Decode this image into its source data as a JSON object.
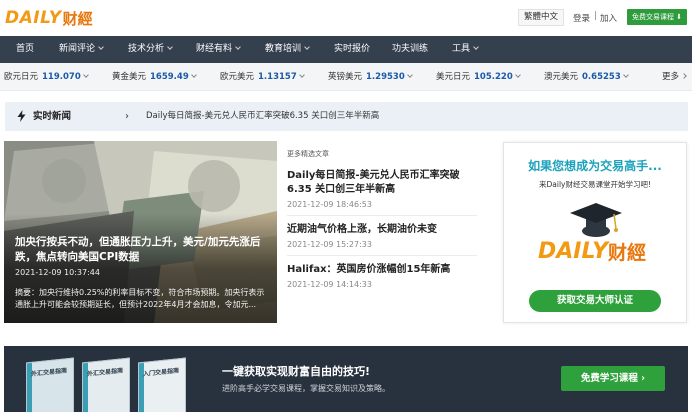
{
  "header": {
    "logo_text": "DAILY",
    "logo_cn": "财經",
    "lang_button": "繁體中文",
    "login": "登录",
    "divider": "|",
    "join": "加入",
    "free_course_button": "免费交易课程 ⬇"
  },
  "nav": {
    "items": [
      {
        "label": "首页",
        "has_caret": false
      },
      {
        "label": "新闻评论",
        "has_caret": true
      },
      {
        "label": "技术分析",
        "has_caret": true
      },
      {
        "label": "财经有料",
        "has_caret": true
      },
      {
        "label": "教育培训",
        "has_caret": true
      },
      {
        "label": "实时报价",
        "has_caret": false
      },
      {
        "label": "功夫训练",
        "has_caret": false
      },
      {
        "label": "工具",
        "has_caret": true
      }
    ]
  },
  "ticker": {
    "items": [
      {
        "name": "欧元日元",
        "value": "119.070"
      },
      {
        "name": "黄金美元",
        "value": "1659.49"
      },
      {
        "name": "欧元美元",
        "value": "1.13157"
      },
      {
        "name": "英镑美元",
        "value": "1.29530"
      },
      {
        "name": "美元日元",
        "value": "105.220"
      },
      {
        "name": "澳元美元",
        "value": "0.65253"
      }
    ],
    "more": "更多"
  },
  "newsbar": {
    "label": "实时新闻",
    "arrow": "›",
    "headline": "Daily每日简报-美元兑人民币汇率突破6.35 关口创三年半新高"
  },
  "feature": {
    "title": "加央行按兵不动，但通胀压力上升，美元/加元先涨后跌，焦点转向美国CPI数据",
    "date": "2021-12-09 10:37:44",
    "summary": "摘要：加央行维持0.25%的利率目标不变，符合市场预期。加央行表示通胀上升可能会较预期延长，但预计2022年4月才会加息，令加元..."
  },
  "articles": {
    "more_label": "更多精选文章",
    "items": [
      {
        "title": "Daily每日简报-美元兑人民币汇率突破6.35 关口创三年半新高",
        "date": "2021-12-09 18:46:53"
      },
      {
        "title": "近期油气价格上涨，长期油价未变",
        "date": "2021-12-09 15:27:33"
      },
      {
        "title": "Halifax：英国房价涨幅创15年新高",
        "date": "2021-12-09 14:14:33"
      }
    ]
  },
  "promo": {
    "heading": "如果您想成为交易高手...",
    "subheading": "来Daily财经交易课堂开始学习吧!",
    "logo_text": "DAILY",
    "logo_cn": "财經",
    "cta": "获取交易大师认证"
  },
  "banner": {
    "title": "一键获取实现财富自由的技巧!",
    "subtitle": "进阶高手必学交易课程，掌握交易知识及策略。",
    "button": "免费学习课程 ›",
    "books": [
      "外汇交易指南",
      "外汇交易指南",
      "入门交易指南"
    ]
  },
  "colors": {
    "nav_bg": "#35404f",
    "accent_green": "#2ea13c",
    "ticker_value": "#1a5aa8",
    "promo_heading": "#1ba2bc",
    "logo_orange": "#f39a14"
  }
}
